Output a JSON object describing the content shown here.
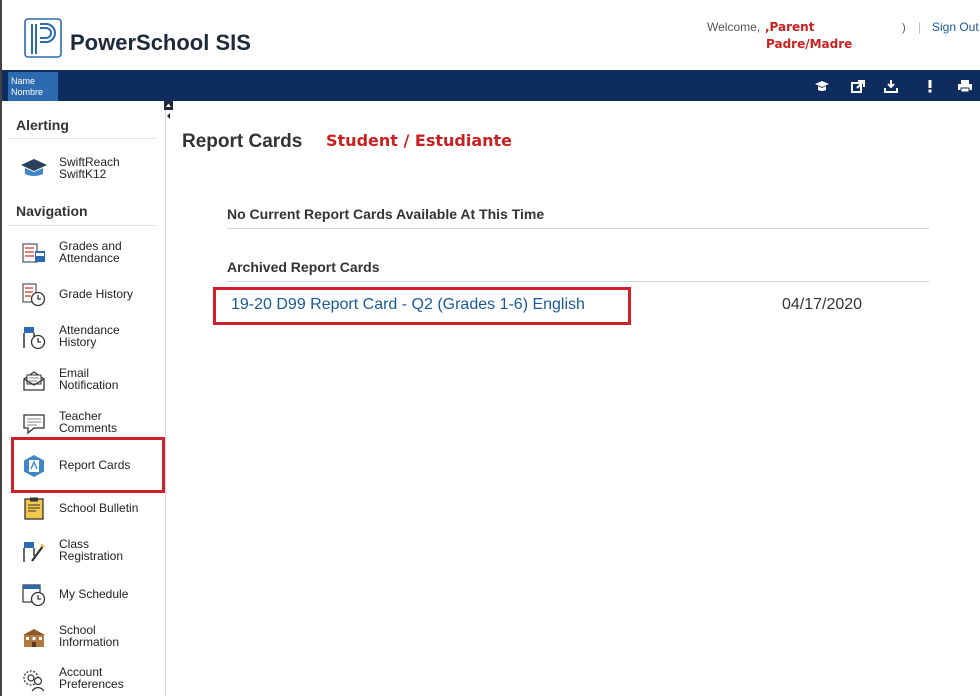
{
  "header": {
    "app_title": "PowerSchool SIS",
    "welcome": "Welcome,",
    "parent_line1": ",Parent",
    "parent_line2": "Padre/Madre",
    "paren": ")",
    "separator": "|",
    "sign_out": "Sign Out"
  },
  "navbar": {
    "name_label": "Name",
    "nombre_label": "Nombre",
    "icons": [
      "graduation-cap-icon",
      "external-link-icon",
      "download-icon",
      "alert-icon",
      "print-icon"
    ]
  },
  "sidebar": {
    "alerting_heading": "Alerting",
    "swiftreach": {
      "line1": "SwiftReach",
      "line2": "SwiftK12"
    },
    "navigation_heading": "Navigation",
    "items": [
      {
        "line1": "Grades and",
        "line2": "Attendance"
      },
      {
        "line1": "Grade History",
        "line2": ""
      },
      {
        "line1": "Attendance",
        "line2": "History"
      },
      {
        "line1": "Email",
        "line2": "Notification"
      },
      {
        "line1": "Teacher",
        "line2": "Comments"
      },
      {
        "line1": "Report Cards",
        "line2": ""
      },
      {
        "line1": "School Bulletin",
        "line2": ""
      },
      {
        "line1": "Class",
        "line2": "Registration"
      },
      {
        "line1": "My Schedule",
        "line2": ""
      },
      {
        "line1": "School",
        "line2": "Information"
      },
      {
        "line1": "Account",
        "line2": "Preferences"
      }
    ]
  },
  "main": {
    "title": "Report Cards",
    "subtitle": "Student / Estudiante",
    "no_current": "No Current Report Cards Available At This Time",
    "archived_heading": "Archived Report Cards",
    "report_cards": [
      {
        "name": "19-20 D99 Report Card - Q2 (Grades 1-6) English",
        "date": "04/17/2020"
      }
    ]
  },
  "colors": {
    "navbar": "#0f2c5e",
    "name_box": "#2d6bb0",
    "link": "#1a5a96",
    "highlight": "#d0202c",
    "annotation_text": "#cc2020"
  }
}
